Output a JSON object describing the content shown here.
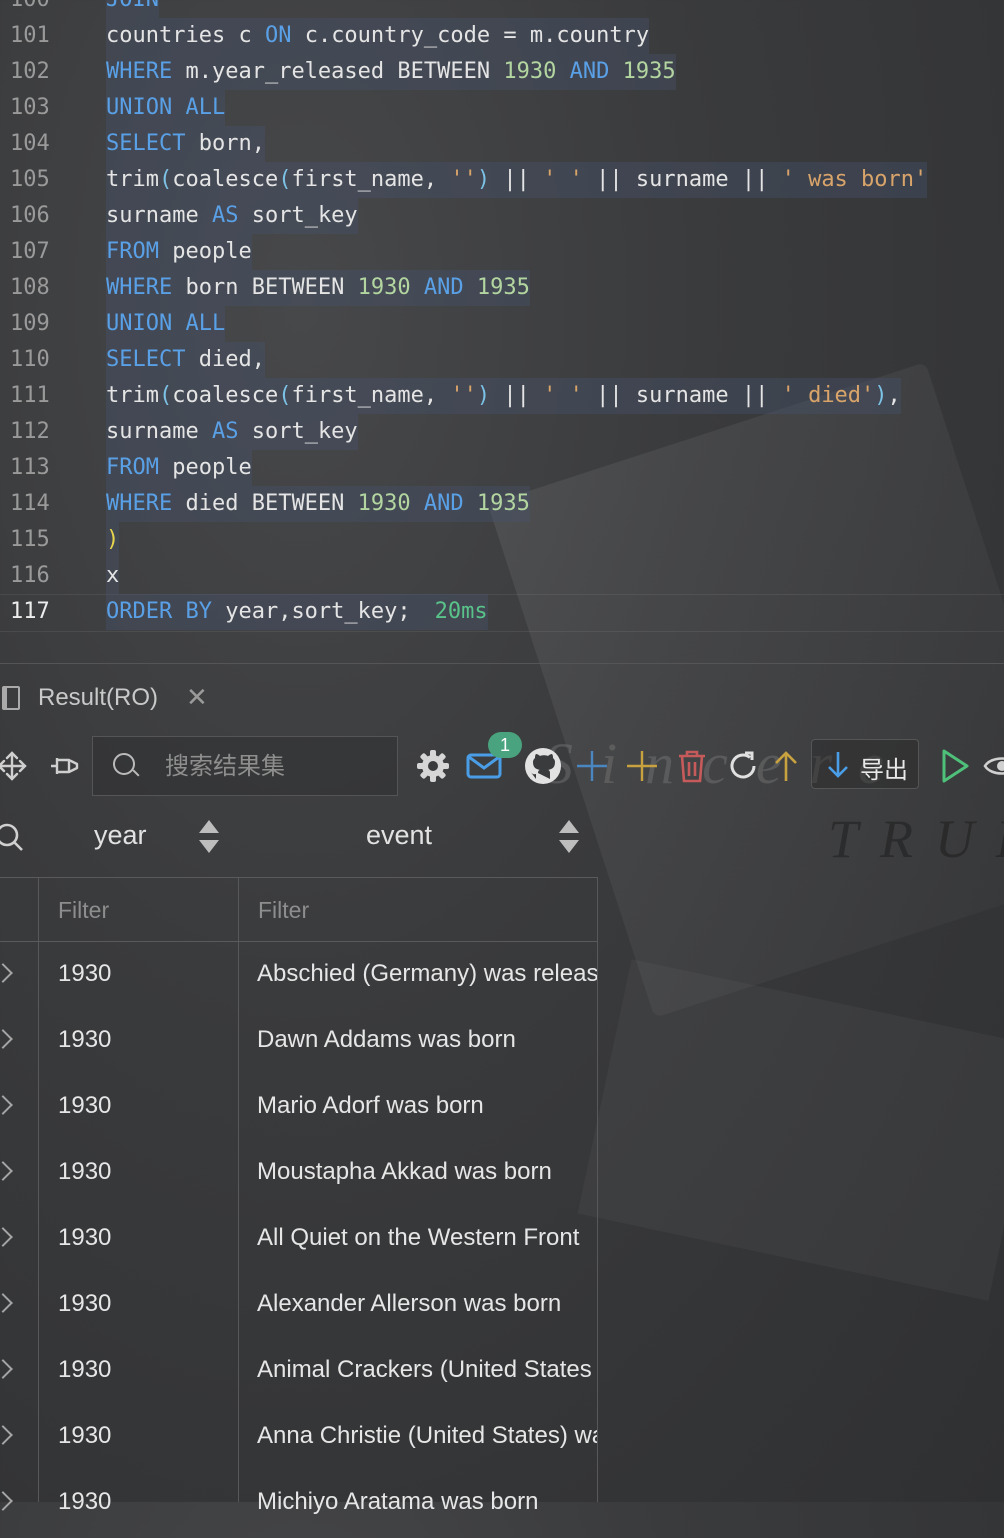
{
  "editor": {
    "lines": [
      {
        "n": "100",
        "segments": [
          [
            "kw",
            "JOIN"
          ]
        ]
      },
      {
        "n": "101",
        "segments": [
          [
            "fn",
            "countries c "
          ],
          [
            "kw",
            "ON"
          ],
          [
            "fn",
            " c.country_code = m.country"
          ]
        ]
      },
      {
        "n": "102",
        "segments": [
          [
            "kw",
            "WHERE"
          ],
          [
            "fn",
            " m.year_released BETWEEN "
          ],
          [
            "num",
            "1930"
          ],
          [
            "fn",
            " "
          ],
          [
            "kw",
            "AND"
          ],
          [
            "fn",
            " "
          ],
          [
            "num",
            "1935"
          ]
        ]
      },
      {
        "n": "103",
        "segments": [
          [
            "kw",
            "UNION ALL"
          ]
        ]
      },
      {
        "n": "104",
        "segments": [
          [
            "kw",
            "SELECT"
          ],
          [
            "fn",
            " born,"
          ]
        ]
      },
      {
        "n": "105",
        "segments": [
          [
            "fn",
            "trim"
          ],
          [
            "paren",
            "("
          ],
          [
            "fn",
            "coalesce"
          ],
          [
            "paren",
            "("
          ],
          [
            "fn",
            "first_name, "
          ],
          [
            "str",
            "''"
          ],
          [
            "paren",
            ")"
          ],
          [
            "fn",
            " || "
          ],
          [
            "str",
            "' '"
          ],
          [
            "fn",
            " || surname || "
          ],
          [
            "str",
            "' was born'"
          ]
        ]
      },
      {
        "n": "106",
        "segments": [
          [
            "fn",
            "surname "
          ],
          [
            "kw",
            "AS"
          ],
          [
            "fn",
            " sort_key"
          ]
        ]
      },
      {
        "n": "107",
        "segments": [
          [
            "kw",
            "FROM"
          ],
          [
            "fn",
            " people"
          ]
        ]
      },
      {
        "n": "108",
        "segments": [
          [
            "kw",
            "WHERE"
          ],
          [
            "fn",
            " born BETWEEN "
          ],
          [
            "num",
            "1930"
          ],
          [
            "fn",
            " "
          ],
          [
            "kw",
            "AND"
          ],
          [
            "fn",
            " "
          ],
          [
            "num",
            "1935"
          ]
        ]
      },
      {
        "n": "109",
        "segments": [
          [
            "kw",
            "UNION ALL"
          ]
        ]
      },
      {
        "n": "110",
        "segments": [
          [
            "kw",
            "SELECT"
          ],
          [
            "fn",
            " died,"
          ]
        ]
      },
      {
        "n": "111",
        "segments": [
          [
            "fn",
            "trim"
          ],
          [
            "paren",
            "("
          ],
          [
            "fn",
            "coalesce"
          ],
          [
            "paren",
            "("
          ],
          [
            "fn",
            "first_name, "
          ],
          [
            "str",
            "''"
          ],
          [
            "paren",
            ")"
          ],
          [
            "fn",
            " || "
          ],
          [
            "str",
            "' '"
          ],
          [
            "fn",
            " || surname || "
          ],
          [
            "str",
            "' died'"
          ],
          [
            "paren",
            ")"
          ],
          [
            "fn",
            ","
          ]
        ]
      },
      {
        "n": "112",
        "segments": [
          [
            "fn",
            "surname "
          ],
          [
            "kw",
            "AS"
          ],
          [
            "fn",
            " sort_key"
          ]
        ]
      },
      {
        "n": "113",
        "segments": [
          [
            "kw",
            "FROM"
          ],
          [
            "fn",
            " people"
          ]
        ]
      },
      {
        "n": "114",
        "segments": [
          [
            "kw",
            "WHERE"
          ],
          [
            "fn",
            " died BETWEEN "
          ],
          [
            "num",
            "1930"
          ],
          [
            "fn",
            " "
          ],
          [
            "kw",
            "AND"
          ],
          [
            "fn",
            " "
          ],
          [
            "num",
            "1935"
          ]
        ]
      },
      {
        "n": "115",
        "segments": [
          [
            "yparen",
            ")"
          ]
        ]
      },
      {
        "n": "116",
        "segments": [
          [
            "fn",
            "x"
          ]
        ]
      },
      {
        "n": "117",
        "segments": [
          [
            "kw",
            "ORDER BY"
          ],
          [
            "fn",
            " year,sort_key;"
          ]
        ],
        "active": true
      }
    ],
    "timing": "20ms"
  },
  "result_tab": {
    "title": "Result(RO)",
    "close": "✕"
  },
  "toolbar": {
    "search_placeholder": "搜索结果集",
    "notification_count": "1",
    "export_label": "导出"
  },
  "grid": {
    "columns": [
      {
        "label": "year",
        "filter_placeholder": "Filter"
      },
      {
        "label": "event",
        "filter_placeholder": "Filter"
      }
    ],
    "rows": [
      {
        "year": "1930",
        "event": "Abschied (Germany) was released"
      },
      {
        "year": "1930",
        "event": "Dawn Addams was born"
      },
      {
        "year": "1930",
        "event": "Mario Adorf was born"
      },
      {
        "year": "1930",
        "event": "Moustapha Akkad was born"
      },
      {
        "year": "1930",
        "event": "All Quiet on the Western Front"
      },
      {
        "year": "1930",
        "event": "Alexander Allerson was born"
      },
      {
        "year": "1930",
        "event": "Animal Crackers (United States"
      },
      {
        "year": "1930",
        "event": "Anna Christie (United States) was released"
      },
      {
        "year": "1930",
        "event": "Michiyo Aratama was born"
      }
    ]
  },
  "wallpaper": {
    "text1": "Sincere",
    "text2": "TRUE"
  },
  "colors": {
    "keyword": "#5aa0e6",
    "number": "#b3d6a0",
    "string": "#d9a46a",
    "accent_green": "#4aa37f"
  }
}
